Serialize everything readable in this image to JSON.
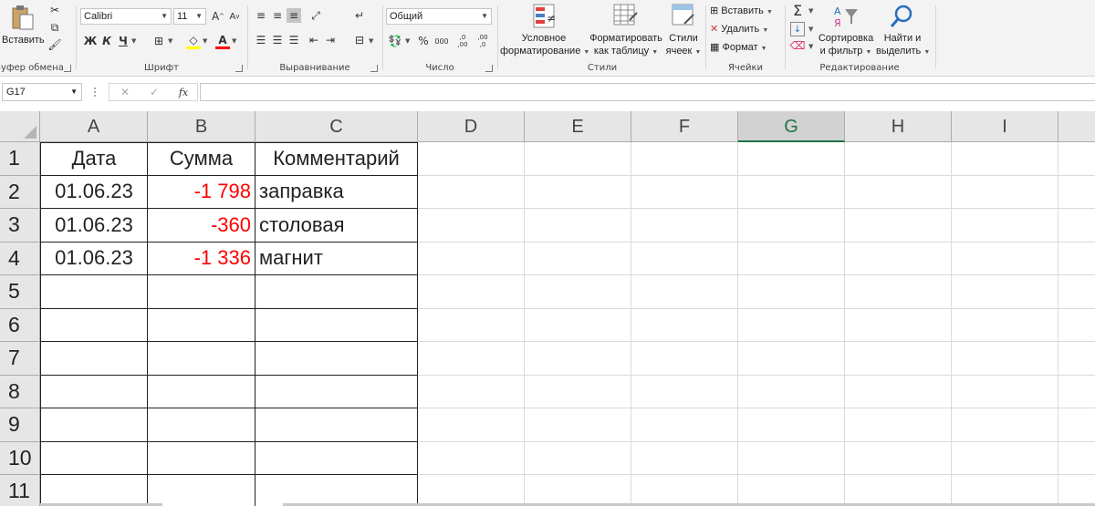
{
  "ribbon": {
    "clipboard": {
      "paste_label": "Вставить",
      "group_label": "Буфер обмена"
    },
    "font": {
      "font_name": "Calibri",
      "font_size": "11",
      "bold": "Ж",
      "italic": "К",
      "underline": "Ч",
      "grow": "A",
      "shrink": "A",
      "group_label": "Шрифт"
    },
    "alignment": {
      "group_label": "Выравнивание"
    },
    "number": {
      "format": "Общий",
      "percent": "%",
      "thousands": "000",
      "inc_decimal": ",0 ,00",
      "dec_decimal": ",00 ,0",
      "group_label": "Число"
    },
    "styles": {
      "conditional_line1": "Условное",
      "conditional_line2": "форматирование",
      "format_table_line1": "Форматировать",
      "format_table_line2": "как таблицу",
      "cell_styles_line1": "Стили",
      "cell_styles_line2": "ячеек",
      "group_label": "Стили"
    },
    "cells": {
      "insert": "Вставить",
      "delete": "Удалить",
      "format": "Формат",
      "group_label": "Ячейки"
    },
    "editing": {
      "sigma": "Σ",
      "sort_line1": "Сортировка",
      "sort_line2": "и фильтр",
      "find_line1": "Найти и",
      "find_line2": "выделить",
      "group_label": "Редактирование"
    }
  },
  "formula_bar": {
    "name_box": "G17",
    "cancel": "✕",
    "enter": "✓",
    "fx": "fx",
    "value": ""
  },
  "sheet": {
    "active_column": "G",
    "columns": [
      "A",
      "B",
      "C",
      "D",
      "E",
      "F",
      "G",
      "H",
      "I"
    ],
    "rows": [
      "1",
      "2",
      "3",
      "4",
      "5",
      "6",
      "7",
      "8",
      "9",
      "10",
      "11"
    ],
    "data": [
      {
        "a": "Дата",
        "b": "Сумма",
        "c": "Комментарий"
      },
      {
        "a": "01.06.23",
        "b": "-1 798",
        "c": "заправка"
      },
      {
        "a": "01.06.23",
        "b": "-360",
        "c": "столовая"
      },
      {
        "a": "01.06.23",
        "b": "-1 336",
        "c": "магнит"
      }
    ],
    "negative_color": "#ff0000",
    "accent_color": "#217346"
  }
}
